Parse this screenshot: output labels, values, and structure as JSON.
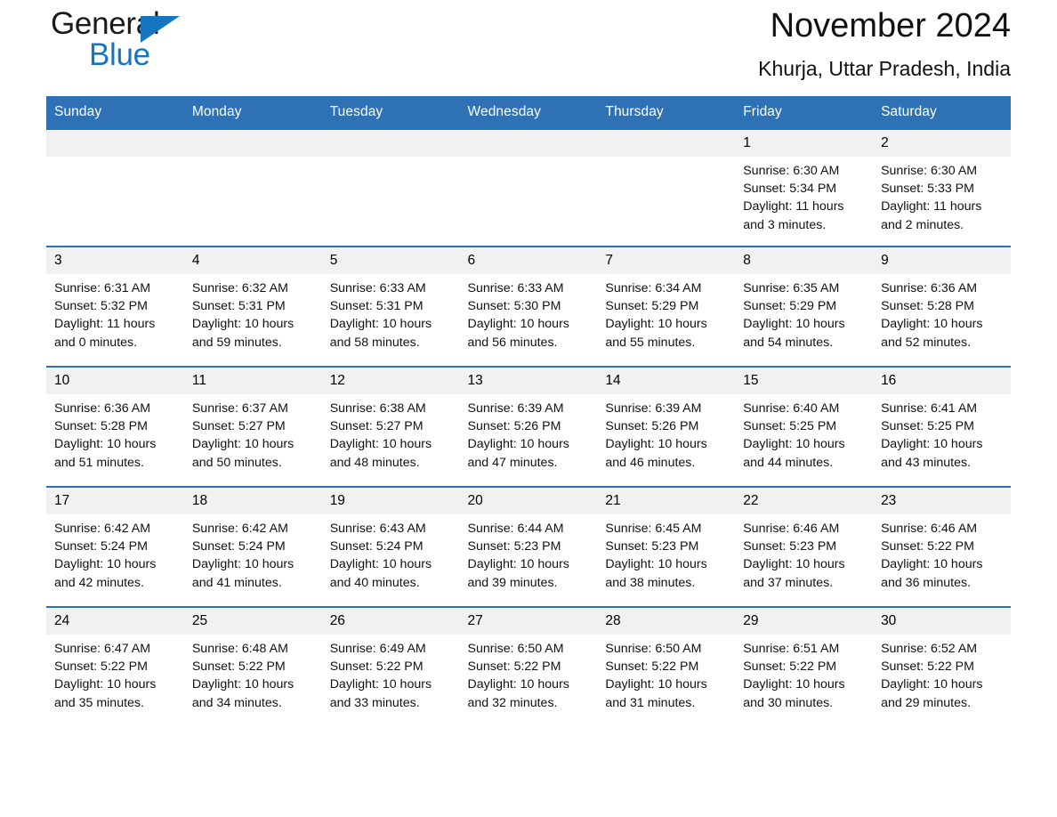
{
  "logo": {
    "word1": "General",
    "word2": "Blue",
    "triangle_color": "#1675c0"
  },
  "header": {
    "title": "November 2024",
    "location": "Khurja, Uttar Pradesh, India"
  },
  "colors": {
    "header_blue": "#2e72b5",
    "daynum_band": "#f1f1f1",
    "text": "#111111"
  },
  "weekday_headers": [
    "Sunday",
    "Monday",
    "Tuesday",
    "Wednesday",
    "Thursday",
    "Friday",
    "Saturday"
  ],
  "labels": {
    "sunrise_prefix": "Sunrise:",
    "sunset_prefix": "Sunset:",
    "daylight_prefix": "Daylight:"
  },
  "weeks": [
    [
      {
        "day": "",
        "empty": true
      },
      {
        "day": "",
        "empty": true
      },
      {
        "day": "",
        "empty": true
      },
      {
        "day": "",
        "empty": true
      },
      {
        "day": "",
        "empty": true
      },
      {
        "day": "1",
        "sunrise": "Sunrise: 6:30 AM",
        "sunset": "Sunset: 5:34 PM",
        "daylight_line1": "Daylight: 11 hours",
        "daylight_line2": "and 3 minutes."
      },
      {
        "day": "2",
        "sunrise": "Sunrise: 6:30 AM",
        "sunset": "Sunset: 5:33 PM",
        "daylight_line1": "Daylight: 11 hours",
        "daylight_line2": "and 2 minutes."
      }
    ],
    [
      {
        "day": "3",
        "sunrise": "Sunrise: 6:31 AM",
        "sunset": "Sunset: 5:32 PM",
        "daylight_line1": "Daylight: 11 hours",
        "daylight_line2": "and 0 minutes."
      },
      {
        "day": "4",
        "sunrise": "Sunrise: 6:32 AM",
        "sunset": "Sunset: 5:31 PM",
        "daylight_line1": "Daylight: 10 hours",
        "daylight_line2": "and 59 minutes."
      },
      {
        "day": "5",
        "sunrise": "Sunrise: 6:33 AM",
        "sunset": "Sunset: 5:31 PM",
        "daylight_line1": "Daylight: 10 hours",
        "daylight_line2": "and 58 minutes."
      },
      {
        "day": "6",
        "sunrise": "Sunrise: 6:33 AM",
        "sunset": "Sunset: 5:30 PM",
        "daylight_line1": "Daylight: 10 hours",
        "daylight_line2": "and 56 minutes."
      },
      {
        "day": "7",
        "sunrise": "Sunrise: 6:34 AM",
        "sunset": "Sunset: 5:29 PM",
        "daylight_line1": "Daylight: 10 hours",
        "daylight_line2": "and 55 minutes."
      },
      {
        "day": "8",
        "sunrise": "Sunrise: 6:35 AM",
        "sunset": "Sunset: 5:29 PM",
        "daylight_line1": "Daylight: 10 hours",
        "daylight_line2": "and 54 minutes."
      },
      {
        "day": "9",
        "sunrise": "Sunrise: 6:36 AM",
        "sunset": "Sunset: 5:28 PM",
        "daylight_line1": "Daylight: 10 hours",
        "daylight_line2": "and 52 minutes."
      }
    ],
    [
      {
        "day": "10",
        "sunrise": "Sunrise: 6:36 AM",
        "sunset": "Sunset: 5:28 PM",
        "daylight_line1": "Daylight: 10 hours",
        "daylight_line2": "and 51 minutes."
      },
      {
        "day": "11",
        "sunrise": "Sunrise: 6:37 AM",
        "sunset": "Sunset: 5:27 PM",
        "daylight_line1": "Daylight: 10 hours",
        "daylight_line2": "and 50 minutes."
      },
      {
        "day": "12",
        "sunrise": "Sunrise: 6:38 AM",
        "sunset": "Sunset: 5:27 PM",
        "daylight_line1": "Daylight: 10 hours",
        "daylight_line2": "and 48 minutes."
      },
      {
        "day": "13",
        "sunrise": "Sunrise: 6:39 AM",
        "sunset": "Sunset: 5:26 PM",
        "daylight_line1": "Daylight: 10 hours",
        "daylight_line2": "and 47 minutes."
      },
      {
        "day": "14",
        "sunrise": "Sunrise: 6:39 AM",
        "sunset": "Sunset: 5:26 PM",
        "daylight_line1": "Daylight: 10 hours",
        "daylight_line2": "and 46 minutes."
      },
      {
        "day": "15",
        "sunrise": "Sunrise: 6:40 AM",
        "sunset": "Sunset: 5:25 PM",
        "daylight_line1": "Daylight: 10 hours",
        "daylight_line2": "and 44 minutes."
      },
      {
        "day": "16",
        "sunrise": "Sunrise: 6:41 AM",
        "sunset": "Sunset: 5:25 PM",
        "daylight_line1": "Daylight: 10 hours",
        "daylight_line2": "and 43 minutes."
      }
    ],
    [
      {
        "day": "17",
        "sunrise": "Sunrise: 6:42 AM",
        "sunset": "Sunset: 5:24 PM",
        "daylight_line1": "Daylight: 10 hours",
        "daylight_line2": "and 42 minutes."
      },
      {
        "day": "18",
        "sunrise": "Sunrise: 6:42 AM",
        "sunset": "Sunset: 5:24 PM",
        "daylight_line1": "Daylight: 10 hours",
        "daylight_line2": "and 41 minutes."
      },
      {
        "day": "19",
        "sunrise": "Sunrise: 6:43 AM",
        "sunset": "Sunset: 5:24 PM",
        "daylight_line1": "Daylight: 10 hours",
        "daylight_line2": "and 40 minutes."
      },
      {
        "day": "20",
        "sunrise": "Sunrise: 6:44 AM",
        "sunset": "Sunset: 5:23 PM",
        "daylight_line1": "Daylight: 10 hours",
        "daylight_line2": "and 39 minutes."
      },
      {
        "day": "21",
        "sunrise": "Sunrise: 6:45 AM",
        "sunset": "Sunset: 5:23 PM",
        "daylight_line1": "Daylight: 10 hours",
        "daylight_line2": "and 38 minutes."
      },
      {
        "day": "22",
        "sunrise": "Sunrise: 6:46 AM",
        "sunset": "Sunset: 5:23 PM",
        "daylight_line1": "Daylight: 10 hours",
        "daylight_line2": "and 37 minutes."
      },
      {
        "day": "23",
        "sunrise": "Sunrise: 6:46 AM",
        "sunset": "Sunset: 5:22 PM",
        "daylight_line1": "Daylight: 10 hours",
        "daylight_line2": "and 36 minutes."
      }
    ],
    [
      {
        "day": "24",
        "sunrise": "Sunrise: 6:47 AM",
        "sunset": "Sunset: 5:22 PM",
        "daylight_line1": "Daylight: 10 hours",
        "daylight_line2": "and 35 minutes."
      },
      {
        "day": "25",
        "sunrise": "Sunrise: 6:48 AM",
        "sunset": "Sunset: 5:22 PM",
        "daylight_line1": "Daylight: 10 hours",
        "daylight_line2": "and 34 minutes."
      },
      {
        "day": "26",
        "sunrise": "Sunrise: 6:49 AM",
        "sunset": "Sunset: 5:22 PM",
        "daylight_line1": "Daylight: 10 hours",
        "daylight_line2": "and 33 minutes."
      },
      {
        "day": "27",
        "sunrise": "Sunrise: 6:50 AM",
        "sunset": "Sunset: 5:22 PM",
        "daylight_line1": "Daylight: 10 hours",
        "daylight_line2": "and 32 minutes."
      },
      {
        "day": "28",
        "sunrise": "Sunrise: 6:50 AM",
        "sunset": "Sunset: 5:22 PM",
        "daylight_line1": "Daylight: 10 hours",
        "daylight_line2": "and 31 minutes."
      },
      {
        "day": "29",
        "sunrise": "Sunrise: 6:51 AM",
        "sunset": "Sunset: 5:22 PM",
        "daylight_line1": "Daylight: 10 hours",
        "daylight_line2": "and 30 minutes."
      },
      {
        "day": "30",
        "sunrise": "Sunrise: 6:52 AM",
        "sunset": "Sunset: 5:22 PM",
        "daylight_line1": "Daylight: 10 hours",
        "daylight_line2": "and 29 minutes."
      }
    ]
  ]
}
